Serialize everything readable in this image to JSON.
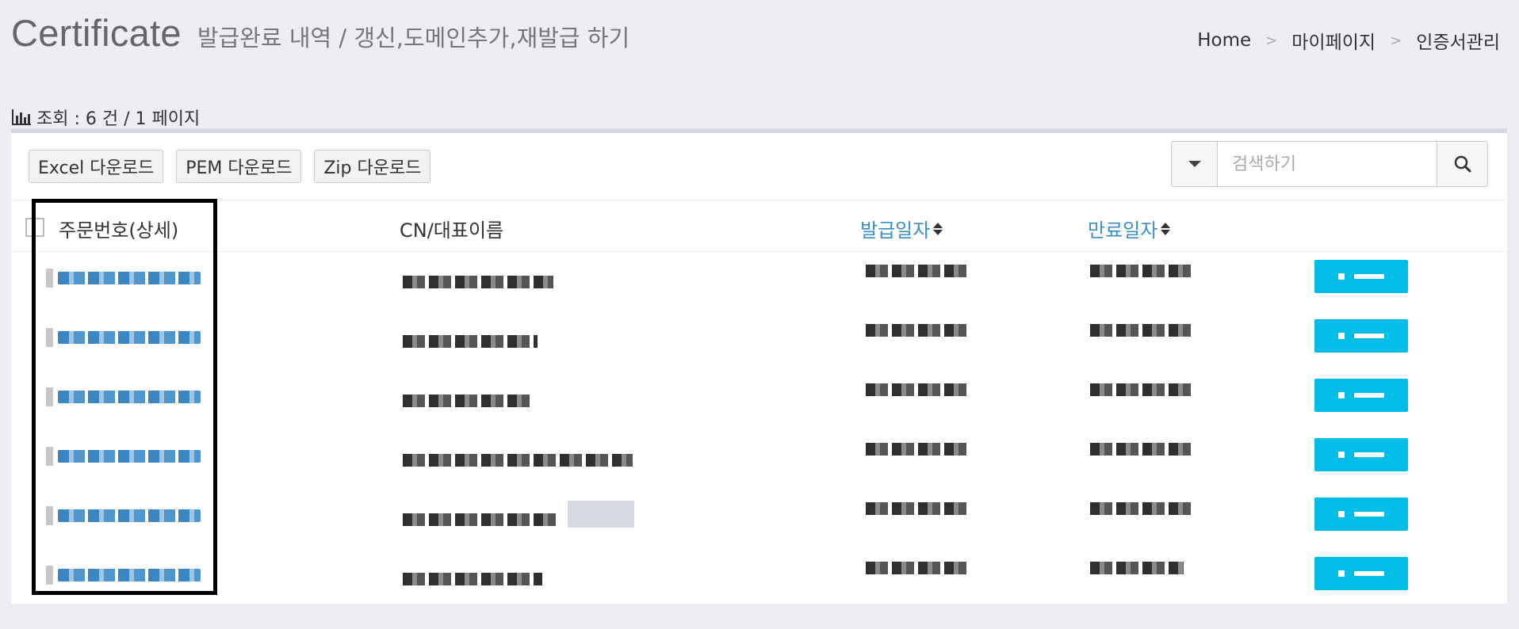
{
  "header": {
    "title": "Certificate",
    "subtitle": "발급완료 내역 / 갱신,도메인추가,재발급 하기"
  },
  "breadcrumb": {
    "items": [
      "Home",
      "마이페이지",
      "인증서관리"
    ],
    "separator": ">"
  },
  "summary": {
    "text": "조회 : 6 건 / 1 페이지",
    "icon": "bar-chart-icon"
  },
  "toolbar": {
    "excel_label": "Excel 다운로드",
    "pem_label": "PEM 다운로드",
    "zip_label": "Zip 다운로드"
  },
  "search": {
    "placeholder": "검색하기",
    "dropdown_icon": "caret-down-icon",
    "button_icon": "search-icon"
  },
  "table": {
    "columns": {
      "order": "주문번호(상세)",
      "cn": "CN/대표이름",
      "issued": "발급일자",
      "expires": "만료일자"
    },
    "row_count": 6
  },
  "colors": {
    "accent_link": "#3a8fc7",
    "status_button": "#00bde8",
    "background": "#eceef4"
  }
}
